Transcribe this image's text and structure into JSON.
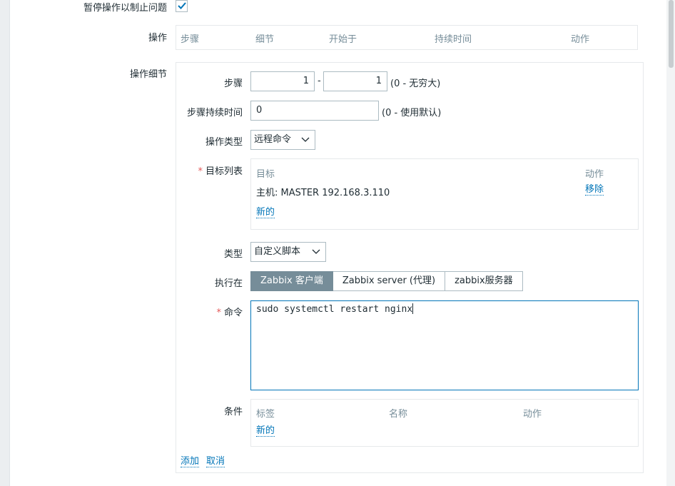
{
  "pause": {
    "label": "暂停操作以制止问题",
    "checked": true
  },
  "operations": {
    "label": "操作",
    "columns": [
      "步骤",
      "细节",
      "开始于",
      "持续时间",
      "动作"
    ]
  },
  "details": {
    "label": "操作细节",
    "steps": {
      "label": "步骤",
      "from": "1",
      "separator": "-",
      "to": "1",
      "hint": "(0 - 无穷大)"
    },
    "step_duration": {
      "label": "步骤持续时间",
      "value": "0",
      "hint": "(0 - 使用默认)"
    },
    "operation_type": {
      "label": "操作类型",
      "value": "远程命令"
    },
    "target_list": {
      "label": "目标列表",
      "columns": {
        "target": "目标",
        "action": "动作"
      },
      "rows": [
        {
          "target": "主机: MASTER 192.168.3.110",
          "action": "移除"
        }
      ],
      "new_link": "新的"
    },
    "type": {
      "label": "类型",
      "value": "自定义脚本"
    },
    "execute_on": {
      "label": "执行在",
      "options": [
        "Zabbix 客户端",
        "Zabbix server (代理)",
        "zabbix服务器"
      ],
      "selected": "Zabbix 客户端"
    },
    "command": {
      "label": "命令",
      "value": "sudo systemctl restart nginx"
    },
    "conditions": {
      "label": "条件",
      "columns": [
        "标签",
        "名称",
        "动作"
      ],
      "new_link": "新的"
    },
    "add_link": "添加",
    "cancel_link": "取消"
  },
  "colors": {
    "link": "#0275b8",
    "required": "#e45959",
    "muted": "#768d99",
    "active_toggle": "#768d99",
    "focus_border": "#0275b8"
  }
}
